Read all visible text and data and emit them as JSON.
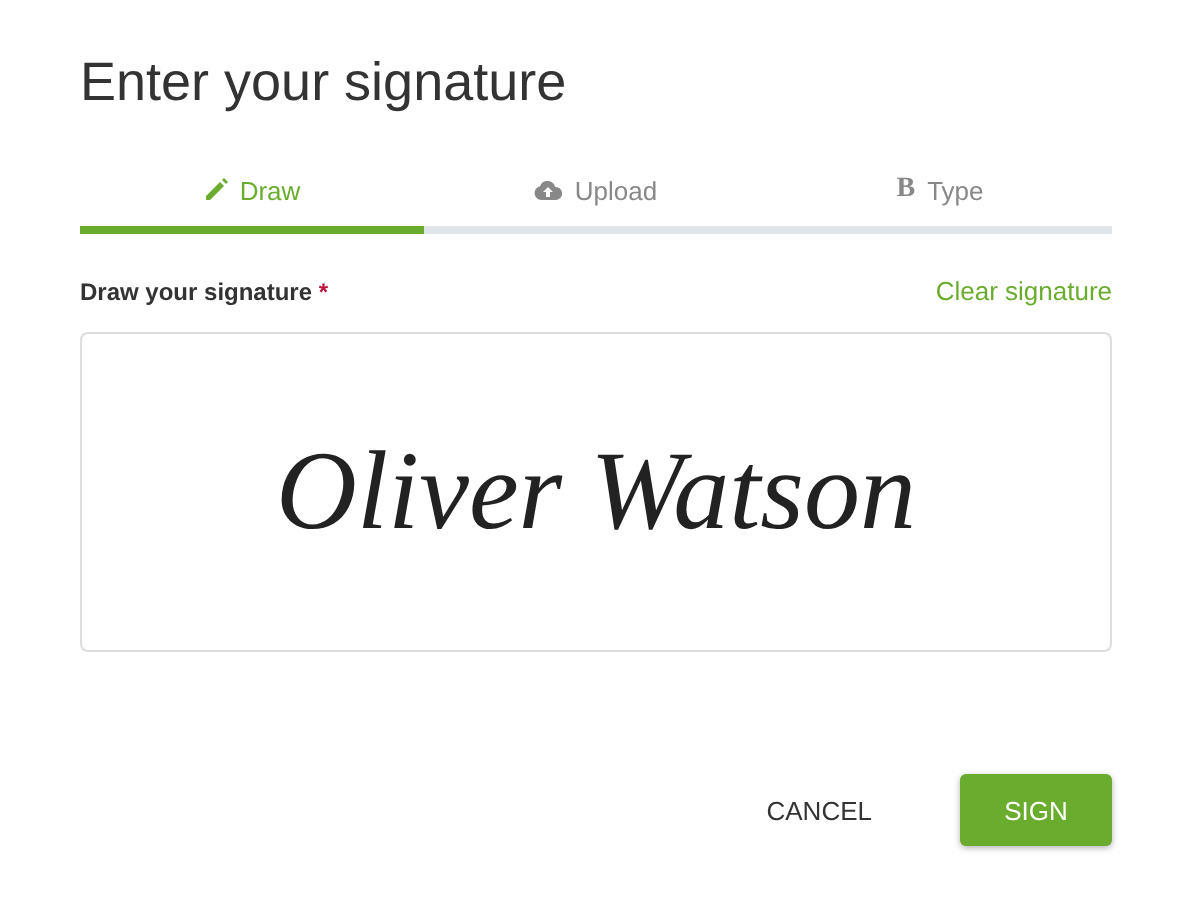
{
  "title": "Enter your signature",
  "tabs": [
    {
      "kind": "pencil",
      "label": "Draw",
      "selected": true
    },
    {
      "kind": "cloud",
      "label": "Upload",
      "selected": false
    },
    {
      "kind": "glyph",
      "glyph": "B",
      "label": "Type",
      "selected": false
    }
  ],
  "field": {
    "label": "Draw your signature",
    "required_mark": "*",
    "clear_link": "Clear signature"
  },
  "signature": "Oliver Watson",
  "buttons": [
    {
      "kind": "flat",
      "label": "CANCEL"
    },
    {
      "kind": "primary",
      "label": "SIGN"
    }
  ]
}
